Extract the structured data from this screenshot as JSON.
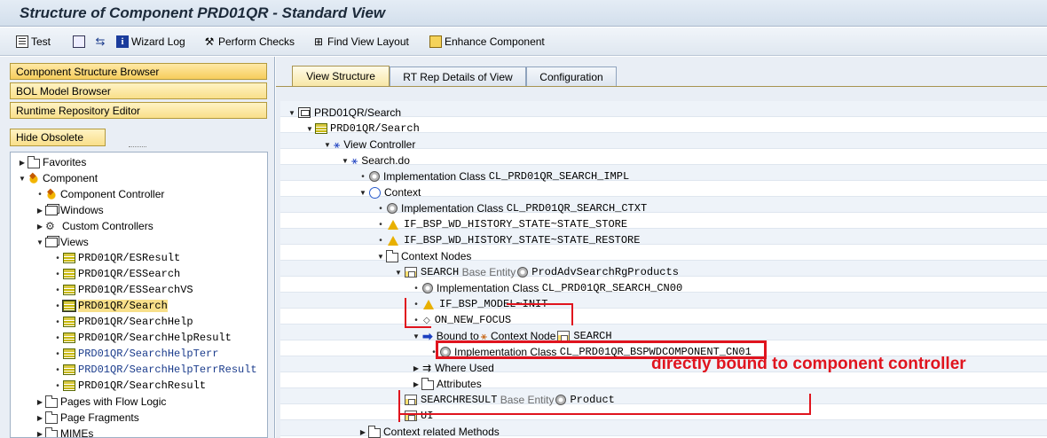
{
  "window": {
    "title": "Structure of Component PRD01QR - Standard View"
  },
  "toolbar": {
    "test": "Test",
    "wizard_log": "Wizard Log",
    "perform_checks": "Perform Checks",
    "find_view_layout": "Find View Layout",
    "enhance_component": "Enhance Component"
  },
  "left": {
    "component_structure_browser": "Component Structure Browser",
    "bol_model_browser": "BOL Model Browser",
    "runtime_repository_editor": "Runtime Repository Editor",
    "hide_obsolete": "Hide Obsolete",
    "tree": {
      "favorites": "Favorites",
      "component": "Component",
      "component_controller": "Component Controller",
      "windows": "Windows",
      "custom_controllers": "Custom Controllers",
      "views": "Views",
      "view_items": [
        "PRD01QR/ESResult",
        "PRD01QR/ESSearch",
        "PRD01QR/ESSearchVS",
        "PRD01QR/Search",
        "PRD01QR/SearchHelp",
        "PRD01QR/SearchHelpResult",
        "PRD01QR/SearchHelpTerr",
        "PRD01QR/SearchHelpTerrResult",
        "PRD01QR/SearchResult"
      ],
      "pages_with_flow_logic": "Pages with Flow Logic",
      "page_fragments": "Page Fragments",
      "mimes": "MIMEs"
    }
  },
  "tabs": [
    {
      "label": "View Structure",
      "active": true
    },
    {
      "label": "RT Rep Details of View",
      "active": false
    },
    {
      "label": "Configuration",
      "active": false
    }
  ],
  "structure": {
    "root": "PRD01QR/Search",
    "view": "PRD01QR/Search",
    "view_controller": "View Controller",
    "search_do": "Search.do",
    "impl_class_label": "Implementation Class",
    "impl_class_search": "CL_PRD01QR_SEARCH_IMPL",
    "context": "Context",
    "impl_class_ctxt": "CL_PRD01QR_SEARCH_CTXT",
    "state_store": "IF_BSP_WD_HISTORY_STATE~STATE_STORE",
    "state_restore": "IF_BSP_WD_HISTORY_STATE~STATE_RESTORE",
    "context_nodes": "Context Nodes",
    "search_node": "SEARCH",
    "base_entity_label": "Base Entity",
    "search_entity": "ProdAdvSearchRgProducts",
    "impl_class_cn00": "CL_PRD01QR_SEARCH_CN00",
    "model_init": "IF_BSP_MODEL~INIT",
    "on_new_focus": "ON_NEW_FOCUS",
    "bound_to": "Bound to",
    "context_node_label": "Context Node",
    "bound_node": "SEARCH",
    "impl_class_cn01": "CL_PRD01QR_BSPWDCOMPONENT_CN01",
    "where_used": "Where Used",
    "attributes": "Attributes",
    "searchresult_node": "SEARCHRESULT",
    "searchresult_entity": "Product",
    "ui_node": "UI",
    "context_related_methods": "Context related Methods"
  },
  "annotation": {
    "text": "directly bound to component controller",
    "color": "#e0141e"
  }
}
